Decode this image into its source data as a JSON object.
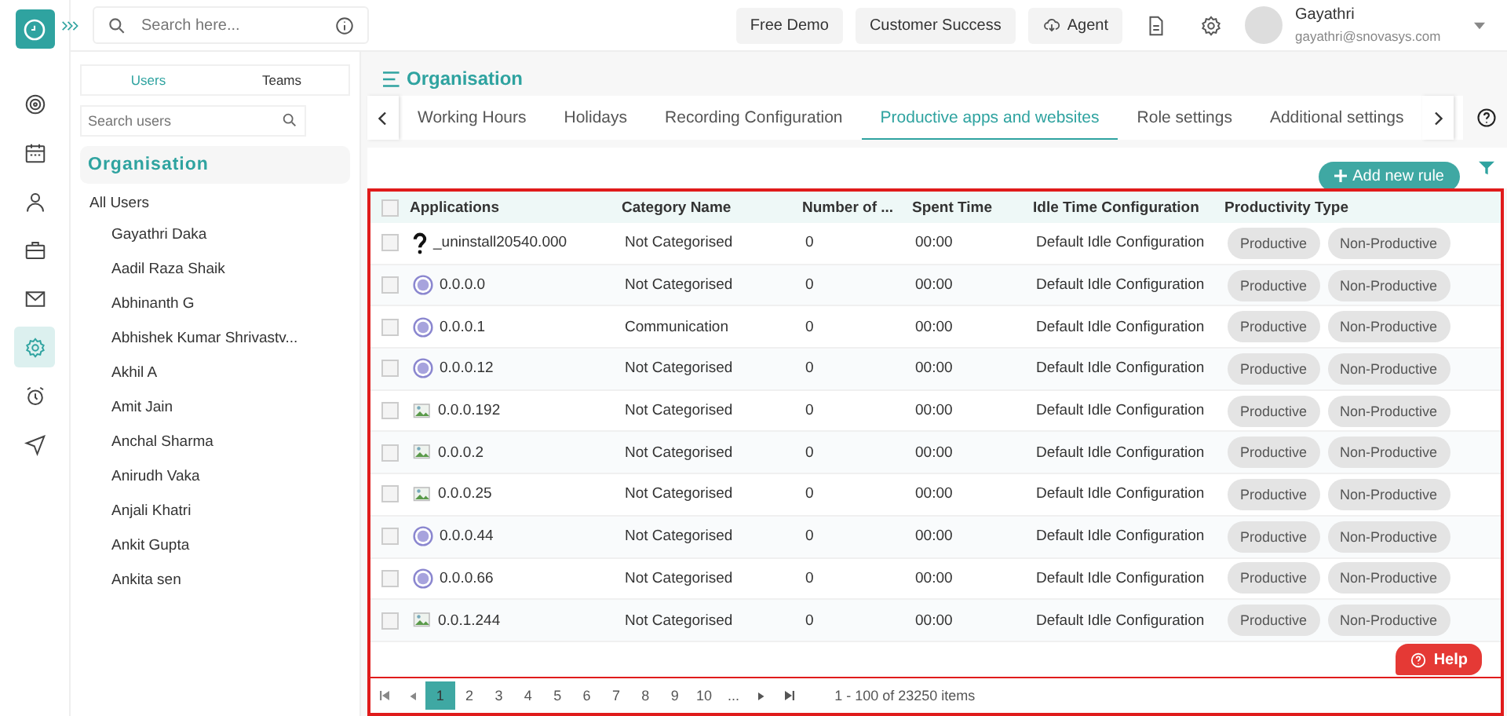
{
  "topbar": {
    "search_placeholder": "Search here...",
    "buttons": [
      "Free Demo",
      "Customer Success",
      "Agent"
    ],
    "user": {
      "name": "Gayathri",
      "email": "gayathri@snovasys.com"
    }
  },
  "rail": [
    {
      "kind": "target",
      "selected": false
    },
    {
      "kind": "calendar",
      "selected": false
    },
    {
      "kind": "person",
      "selected": false
    },
    {
      "kind": "briefcase",
      "selected": false
    },
    {
      "kind": "mail",
      "selected": false
    },
    {
      "kind": "gear",
      "selected": true
    },
    {
      "kind": "alarm",
      "selected": false
    },
    {
      "kind": "send",
      "selected": false
    }
  ],
  "sidebar": {
    "tabs": [
      {
        "label": "Users",
        "selected": true
      },
      {
        "label": "Teams",
        "selected": false
      }
    ],
    "search_placeholder": "Search users",
    "heading": "Organisation",
    "group": "All Users",
    "users": [
      "Gayathri Daka",
      "Aadil Raza Shaik",
      "Abhinanth G",
      "Abhishek Kumar Shrivastv...",
      "Akhil A",
      "Amit Jain",
      "Anchal Sharma",
      "Anirudh Vaka",
      "Anjali Khatri",
      "Ankit Gupta",
      "Ankita sen"
    ]
  },
  "page_title": "Organisation",
  "tabs": [
    {
      "label": "Working Hours",
      "selected": false
    },
    {
      "label": "Holidays",
      "selected": false
    },
    {
      "label": "Recording Configuration",
      "selected": false
    },
    {
      "label": "Productive apps and websites",
      "selected": true
    },
    {
      "label": "Role settings",
      "selected": false
    },
    {
      "label": "Additional settings",
      "selected": false
    }
  ],
  "add_button": "Add new rule",
  "table": {
    "select_all_checked": false,
    "columns": [
      "Applications",
      "Category Name",
      "Number of ...",
      "Spent Time",
      "Idle Time Configuration",
      "Productivity Type"
    ],
    "rows": [
      {
        "kind": "unknown",
        "checked": false,
        "name": "_uninstall20540.000",
        "category": "Not Categorised",
        "count": "0",
        "spent": "00:00",
        "idle": "Default Idle Configuration",
        "types": [
          "Productive",
          "Non-Productive"
        ]
      },
      {
        "kind": "globe",
        "checked": false,
        "name": "0.0.0.0",
        "category": "Not Categorised",
        "count": "0",
        "spent": "00:00",
        "idle": "Default Idle Configuration",
        "types": [
          "Productive",
          "Non-Productive"
        ]
      },
      {
        "kind": "globe",
        "checked": false,
        "name": "0.0.0.1",
        "category": "Communication",
        "count": "0",
        "spent": "00:00",
        "idle": "Default Idle Configuration",
        "types": [
          "Productive",
          "Non-Productive"
        ]
      },
      {
        "kind": "globe",
        "checked": false,
        "name": "0.0.0.12",
        "category": "Not Categorised",
        "count": "0",
        "spent": "00:00",
        "idle": "Default Idle Configuration",
        "types": [
          "Productive",
          "Non-Productive"
        ]
      },
      {
        "kind": "broken",
        "checked": false,
        "name": "0.0.0.192",
        "category": "Not Categorised",
        "count": "0",
        "spent": "00:00",
        "idle": "Default Idle Configuration",
        "types": [
          "Productive",
          "Non-Productive"
        ]
      },
      {
        "kind": "broken",
        "checked": false,
        "name": "0.0.0.2",
        "category": "Not Categorised",
        "count": "0",
        "spent": "00:00",
        "idle": "Default Idle Configuration",
        "types": [
          "Productive",
          "Non-Productive"
        ]
      },
      {
        "kind": "broken",
        "checked": false,
        "name": "0.0.0.25",
        "category": "Not Categorised",
        "count": "0",
        "spent": "00:00",
        "idle": "Default Idle Configuration",
        "types": [
          "Productive",
          "Non-Productive"
        ]
      },
      {
        "kind": "globe",
        "checked": false,
        "name": "0.0.0.44",
        "category": "Not Categorised",
        "count": "0",
        "spent": "00:00",
        "idle": "Default Idle Configuration",
        "types": [
          "Productive",
          "Non-Productive"
        ]
      },
      {
        "kind": "globe",
        "checked": false,
        "name": "0.0.0.66",
        "category": "Not Categorised",
        "count": "0",
        "spent": "00:00",
        "idle": "Default Idle Configuration",
        "types": [
          "Productive",
          "Non-Productive"
        ]
      },
      {
        "kind": "broken",
        "checked": false,
        "name": "0.0.1.244",
        "category": "Not Categorised",
        "count": "0",
        "spent": "00:00",
        "idle": "Default Idle Configuration",
        "types": [
          "Productive",
          "Non-Productive"
        ]
      }
    ]
  },
  "pagination": {
    "pages": [
      {
        "label": "1",
        "selected": true
      },
      {
        "label": "2",
        "selected": false
      },
      {
        "label": "3",
        "selected": false
      },
      {
        "label": "4",
        "selected": false
      },
      {
        "label": "5",
        "selected": false
      },
      {
        "label": "6",
        "selected": false
      },
      {
        "label": "7",
        "selected": false
      },
      {
        "label": "8",
        "selected": false
      },
      {
        "label": "9",
        "selected": false
      },
      {
        "label": "10",
        "selected": false
      },
      {
        "label": "...",
        "selected": false
      }
    ],
    "summary": "1 - 100 of 23250 items"
  },
  "help_button": "Help"
}
